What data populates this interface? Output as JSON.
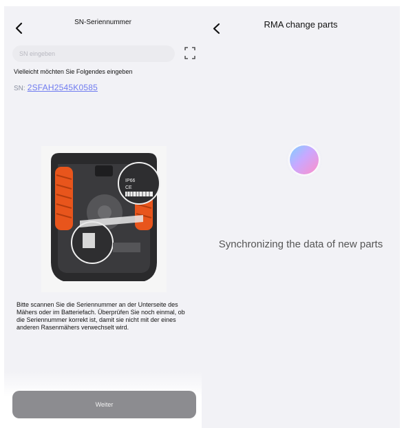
{
  "left_screen": {
    "title": "SN-Seriennummer",
    "search": {
      "placeholder": "SN eingeben",
      "value": ""
    },
    "hint": "Vielleicht möchten Sie Folgendes eingeben",
    "sn_prefix": "SN:",
    "sn_suggestion": "2SFAH2545K0585",
    "image_labels": {
      "rating": "IP66",
      "marks": "CE"
    },
    "description": "Bitte scannen Sie die Seriennummer an der Unterseite des Mähers oder im Batteriefach. Überprüfen Sie noch einmal, ob die Seriennummer korrekt ist, damit sie nicht mit der eines anderen Rasenmähers verwechselt wird.",
    "continue_label": "Weiter"
  },
  "right_screen": {
    "title": "RMA change parts",
    "status_text": "Synchronizing the data of new parts"
  },
  "icons": [
    "back-chevron-icon",
    "scan-icon"
  ],
  "colors": {
    "background": "#f2f2f6",
    "link": "#6f7bf0",
    "button": "#8c8c90",
    "wheel_orange": "#e8551c"
  }
}
